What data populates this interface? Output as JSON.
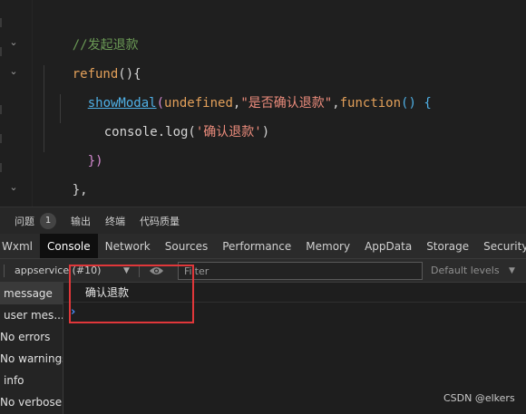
{
  "editor": {
    "line1_comment": "//发起退款",
    "line2_fn": "refund",
    "line2_rest": "(){",
    "line3_call": "showModal",
    "line3_paren_open": "(",
    "line3_arg1": "undefined",
    "line3_comma": ",",
    "line3_arg2": "\"是否确认退款\"",
    "line3_comma2": ",",
    "line3_kw": "function",
    "line3_tail": "() {",
    "line4_obj": "console.log(",
    "line4_str": "'确认退款'",
    "line4_close": ")",
    "line5_close": "})",
    "line6_close": "},",
    "line7_comment": "/**"
  },
  "panel_tabs": {
    "problems_label": "问题",
    "problems_count": "1",
    "output_label": "输出",
    "terminal_label": "终端",
    "quality_label": "代码质量"
  },
  "devtools_tabs": [
    "Wxml",
    "Console",
    "Network",
    "Sources",
    "Performance",
    "Memory",
    "AppData",
    "Storage",
    "Security"
  ],
  "toolbar": {
    "context": "appservice (#10)",
    "filter_placeholder": "Filter",
    "levels": "Default levels"
  },
  "sidebar": {
    "items": [
      "message",
      "user mes...",
      "No errors",
      "No warnings",
      "info",
      "No verbose"
    ]
  },
  "console": {
    "log_text": "确认退款",
    "prompt": "›"
  },
  "watermark": "CSDN @elkers",
  "colors": {
    "highlight": "#e0373a",
    "prompt": "#4a8bf5"
  }
}
